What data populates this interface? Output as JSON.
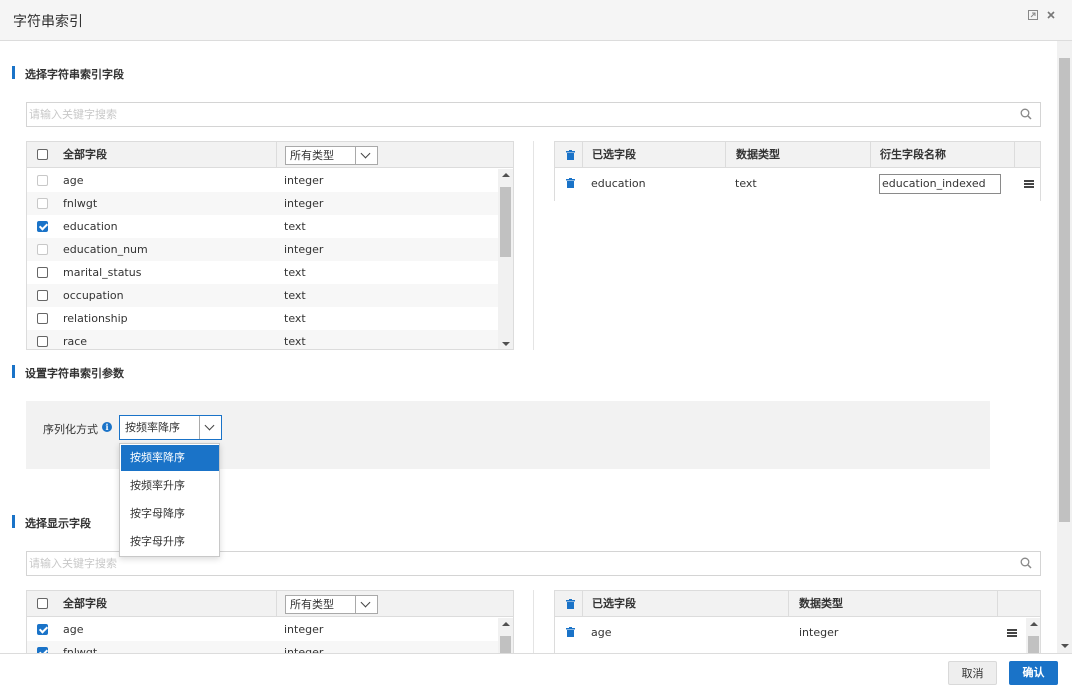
{
  "window": {
    "title": "字符串索引"
  },
  "section1": {
    "title": "选择字符串索引字段",
    "search_placeholder": "请输入关键字搜索",
    "left_table": {
      "header_all": "全部字段",
      "type_filter": "所有类型",
      "rows": [
        {
          "name": "age",
          "type": "integer",
          "state": "disabled"
        },
        {
          "name": "fnlwgt",
          "type": "integer",
          "state": "disabled"
        },
        {
          "name": "education",
          "type": "text",
          "state": "checked"
        },
        {
          "name": "education_num",
          "type": "integer",
          "state": "disabled"
        },
        {
          "name": "marital_status",
          "type": "text",
          "state": "unchecked"
        },
        {
          "name": "occupation",
          "type": "text",
          "state": "unchecked"
        },
        {
          "name": "relationship",
          "type": "text",
          "state": "unchecked"
        },
        {
          "name": "race",
          "type": "text",
          "state": "unchecked"
        }
      ]
    },
    "right_table": {
      "header_selected": "已选字段",
      "header_type": "数据类型",
      "header_derived": "衍生字段名称",
      "rows": [
        {
          "name": "education",
          "type": "text",
          "derived": "education_indexed"
        }
      ]
    }
  },
  "section2": {
    "title": "设置字符串索引参数",
    "param_label": "序列化方式",
    "selected": "按频率降序",
    "options": [
      "按频率降序",
      "按频率升序",
      "按字母降序",
      "按字母升序"
    ]
  },
  "section3": {
    "title": "选择显示字段",
    "search_placeholder": "请输入关键字搜索",
    "left_table": {
      "header_all": "全部字段",
      "type_filter": "所有类型",
      "rows": [
        {
          "name": "age",
          "type": "integer",
          "state": "checked"
        },
        {
          "name": "fnlwgt",
          "type": "integer",
          "state": "checked"
        }
      ]
    },
    "right_table": {
      "header_selected": "已选字段",
      "header_type": "数据类型",
      "rows": [
        {
          "name": "age",
          "type": "integer"
        }
      ]
    }
  },
  "footer": {
    "cancel": "取消",
    "ok": "确认"
  },
  "colors": {
    "accent": "#1a73c8"
  }
}
